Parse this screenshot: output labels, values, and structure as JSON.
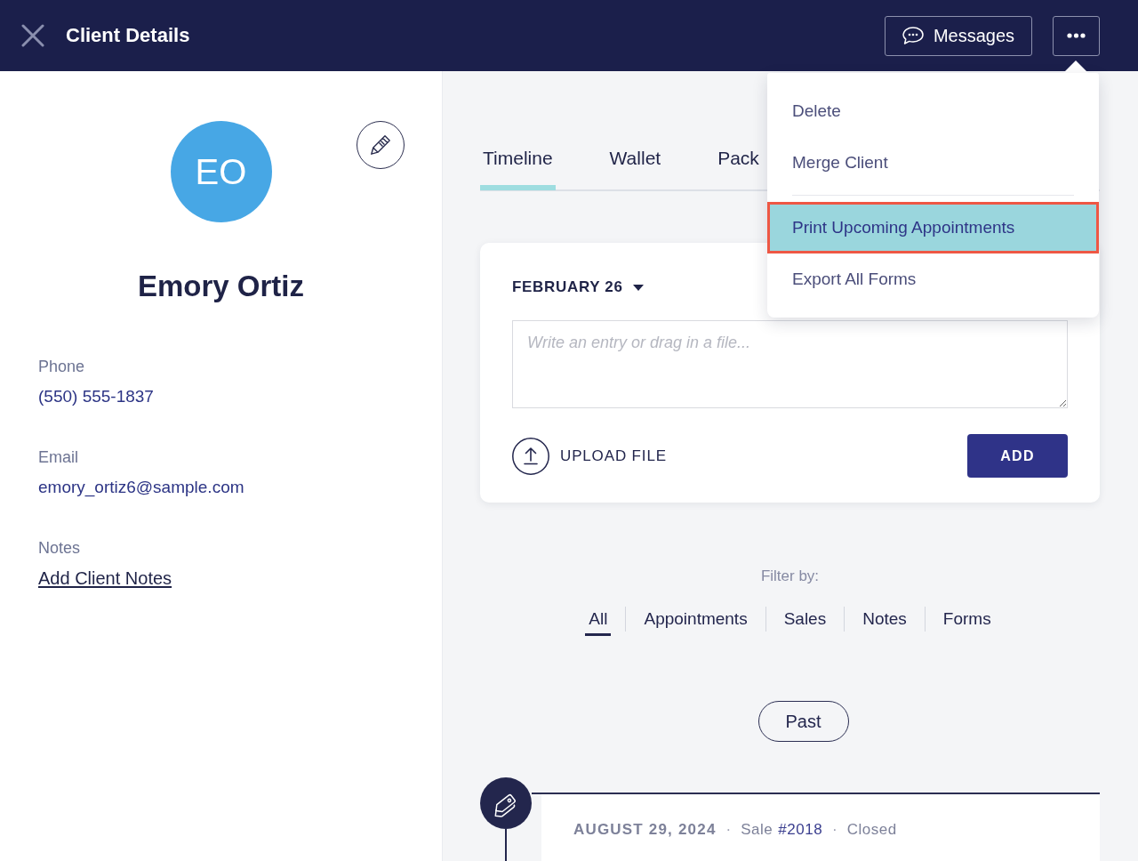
{
  "header": {
    "title": "Client Details",
    "messages_button": "Messages"
  },
  "more_menu": {
    "sections": [
      {
        "items": [
          {
            "label": "Delete",
            "selected": false
          },
          {
            "label": "Merge Client",
            "selected": false
          }
        ]
      },
      {
        "items": [
          {
            "label": "Print Upcoming Appointments",
            "selected": true
          },
          {
            "label": "Export All Forms",
            "selected": false
          }
        ]
      }
    ]
  },
  "client": {
    "initials": "EO",
    "name": "Emory Ortiz",
    "fields": [
      {
        "label": "Phone",
        "value": "(550) 555-1837",
        "kind": "text"
      },
      {
        "label": "Email",
        "value": "emory_ortiz6@sample.com",
        "kind": "text"
      },
      {
        "label": "Notes",
        "value": "Add Client Notes",
        "kind": "link"
      }
    ]
  },
  "tabs": [
    {
      "label": "Timeline",
      "selected": true
    },
    {
      "label": "Wallet",
      "selected": false
    },
    {
      "label": "Pack",
      "selected": false
    }
  ],
  "entry_form": {
    "date": "FEBRUARY 26",
    "entry_field": {
      "placeholder": "Write an entry or drag in a file..."
    },
    "upload_button": "UPLOAD FILE",
    "add_button": "ADD"
  },
  "filter": {
    "label": "Filter by:",
    "options": [
      {
        "label": "All",
        "selected": true
      },
      {
        "label": "Appointments",
        "selected": false
      },
      {
        "label": "Sales",
        "selected": false
      },
      {
        "label": "Notes",
        "selected": false
      },
      {
        "label": "Forms",
        "selected": false
      }
    ]
  },
  "past_button": "Past",
  "timeline": [
    {
      "kind": "sale",
      "parts": [
        {
          "kind": "date",
          "text": "AUGUST 29, 2024"
        },
        {
          "kind": "separator",
          "text": "·"
        },
        {
          "kind": "label",
          "text": "Sale"
        },
        {
          "kind": "link",
          "text": "#2018"
        },
        {
          "kind": "separator",
          "text": "·"
        },
        {
          "kind": "status",
          "text": "Closed"
        }
      ]
    }
  ]
}
